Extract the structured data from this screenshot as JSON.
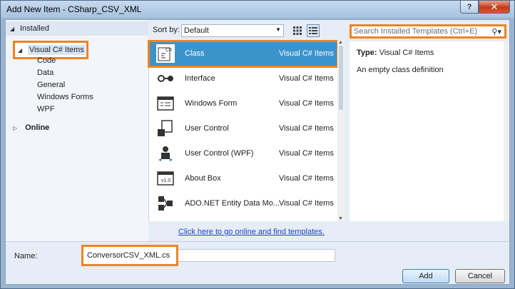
{
  "window": {
    "title": "Add New Item - CSharp_CSV_XML",
    "help_label": "?",
    "close_label": "✕"
  },
  "tree": {
    "installed": "Installed",
    "selected": "Visual C# Items",
    "children": [
      "Code",
      "Data",
      "General",
      "Windows Forms",
      "WPF"
    ],
    "online": "Online"
  },
  "toolbar": {
    "sort_label": "Sort by:",
    "sort_value": "Default",
    "search_placeholder": "Search Installed Templates (Ctrl+E)"
  },
  "templates": [
    {
      "name": "Class",
      "category": "Visual C# Items",
      "icon": "class-icon",
      "selected": true
    },
    {
      "name": "Interface",
      "category": "Visual C# Items",
      "icon": "interface-icon"
    },
    {
      "name": "Windows Form",
      "category": "Visual C# Items",
      "icon": "windows-form-icon"
    },
    {
      "name": "User Control",
      "category": "Visual C# Items",
      "icon": "user-control-icon"
    },
    {
      "name": "User Control (WPF)",
      "category": "Visual C# Items",
      "icon": "user-control-wpf-icon"
    },
    {
      "name": "About Box",
      "category": "Visual C# Items",
      "icon": "about-box-icon"
    },
    {
      "name": "ADO.NET Entity Data Mo...",
      "category": "Visual C# Items",
      "icon": "entity-data-model-icon"
    }
  ],
  "online_link": "Click here to go online and find templates.",
  "details": {
    "type_label": "Type:",
    "type_value": "Visual C# Items",
    "description": "An empty class definition"
  },
  "bottom": {
    "name_label": "Name:",
    "name_value": "ConversorCSV_XML.cs",
    "add_label": "Add",
    "cancel_label": "Cancel"
  },
  "colors": {
    "highlight_border": "#f08321",
    "selection": "#3c93cb",
    "link": "#1a3fd0"
  }
}
